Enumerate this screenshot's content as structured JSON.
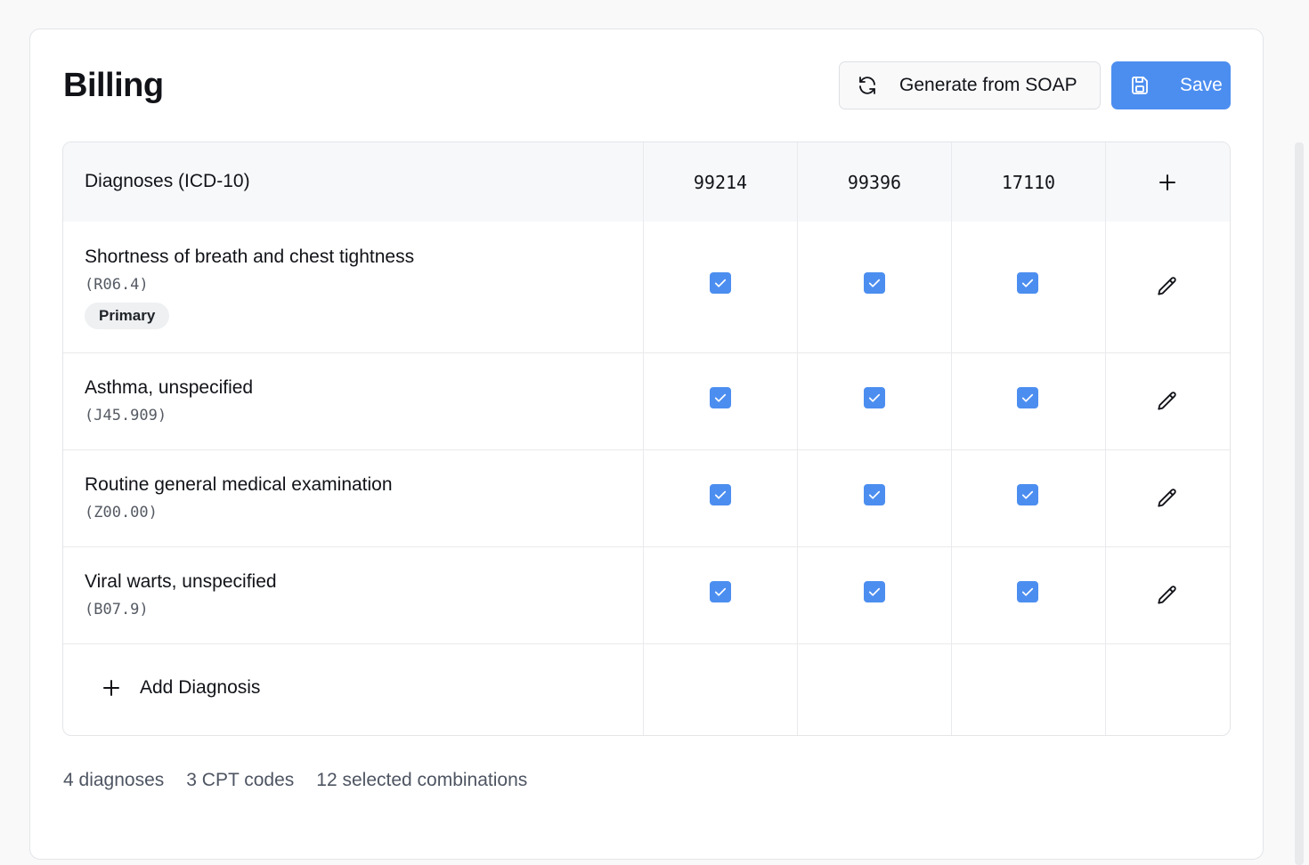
{
  "billing": {
    "title": "Billing",
    "generate_label": "Generate from SOAP",
    "save_label": "Save"
  },
  "table": {
    "diag_header": "Diagnoses (ICD-10)",
    "cpt_codes": [
      "99214",
      "99396",
      "17110"
    ],
    "rows": [
      {
        "name": "Shortness of breath and chest tightness",
        "code": "(R06.4)",
        "badge": "Primary",
        "checks": [
          true,
          true,
          true
        ]
      },
      {
        "name": "Asthma, unspecified",
        "code": "(J45.909)",
        "checks": [
          true,
          true,
          true
        ]
      },
      {
        "name": "Routine general medical examination",
        "code": "(Z00.00)",
        "checks": [
          true,
          true,
          true
        ]
      },
      {
        "name": "Viral warts, unspecified",
        "code": "(B07.9)",
        "checks": [
          true,
          true,
          true
        ]
      }
    ],
    "add_label": "Add Diagnosis"
  },
  "footer": {
    "diagnoses": "4 diagnoses",
    "cpt": "3 CPT codes",
    "combos": "12 selected combinations"
  },
  "colors": {
    "accent": "#4c8ef0",
    "header_bg": "#f7f8fa"
  },
  "icons": {
    "generate": "refresh-icon",
    "save": "floppy-disk-icon",
    "add_cpt": "plus-icon",
    "edit": "pencil-icon",
    "check": "checkbox-checked-icon"
  }
}
